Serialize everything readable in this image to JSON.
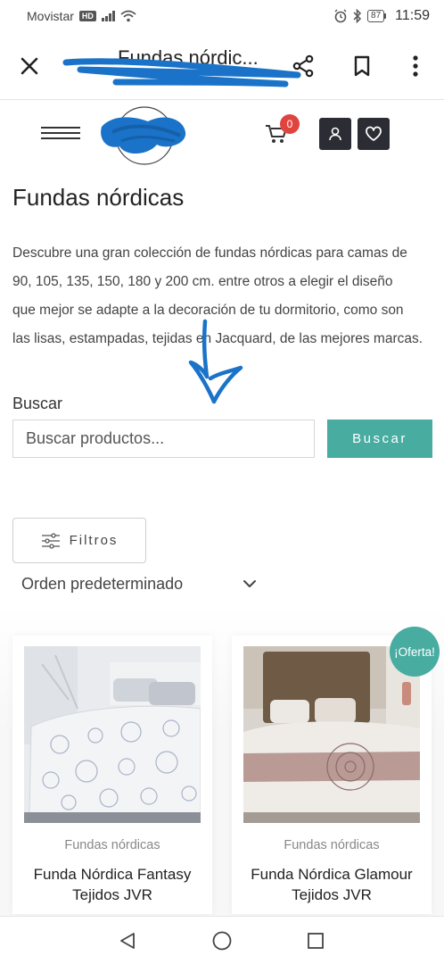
{
  "status_bar": {
    "carrier": "Movistar",
    "network_badge": "HD",
    "battery": "87",
    "time": "11:59"
  },
  "toolbar": {
    "title": "Fundas nórdic...",
    "icons": [
      "close-icon",
      "share-icon",
      "bookmark-icon",
      "more-vertical-icon"
    ]
  },
  "header": {
    "cart_count": "0",
    "icons": [
      "hamburger-menu-icon",
      "cart-icon",
      "user-icon",
      "heart-icon"
    ]
  },
  "main": {
    "title": "Fundas nórdicas",
    "description_lines": [
      "Descubre una gran colección de fundas nórdicas para camas de",
      "90, 105, 135, 150, 180 y 200 cm. entre otros a elegir el diseño",
      "que mejor se adapte a la decoración de tu dormitorio, como son",
      "las lisas, estampadas, tejidas en Jacquard, de las mejores marcas."
    ]
  },
  "search": {
    "label": "Buscar",
    "placeholder": "Buscar productos...",
    "button": "Buscar"
  },
  "filters": {
    "button": "Filtros",
    "sort_selected": "Orden predeterminado"
  },
  "products": [
    {
      "category": "Fundas nórdicas",
      "name_line1": "Funda Nórdica Fantasy",
      "name_line2": "Tejidos JVR",
      "badge": ""
    },
    {
      "category": "Fundas nórdicas",
      "name_line1": "Funda Nórdica Glamour",
      "name_line2": "Tejidos JVR",
      "badge": "¡Oferta!"
    }
  ],
  "colors": {
    "accent": "#48aca1",
    "cart_badge": "#e0443f",
    "dark_button": "#2c2c34",
    "annotation": "#1a73c8"
  }
}
